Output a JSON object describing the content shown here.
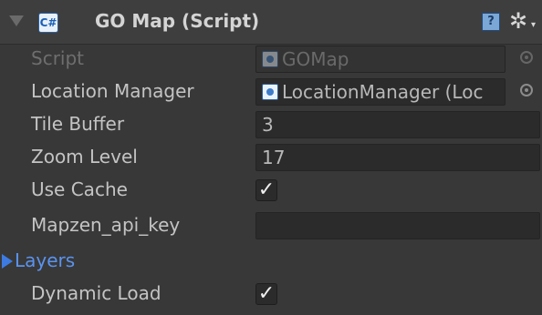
{
  "component": {
    "title": "GO Map (Script)",
    "script_icon_glyph": "C#",
    "help_glyph": "?",
    "gear_glyph": "✲",
    "gear_caret_glyph": "▾"
  },
  "fields": {
    "script": {
      "label": "Script",
      "value": "GOMap"
    },
    "location_manager": {
      "label": "Location Manager",
      "value": "LocationManager (Loc"
    },
    "tile_buffer": {
      "label": "Tile Buffer",
      "value": "3"
    },
    "zoom_level": {
      "label": "Zoom Level",
      "value": "17"
    },
    "use_cache": {
      "label": "Use Cache",
      "checked_glyph": "✓"
    },
    "mapzen_api_key": {
      "label": "Mapzen_api_key",
      "value": ""
    },
    "layers": {
      "label": "Layers"
    },
    "dynamic_load": {
      "label": "Dynamic Load",
      "checked_glyph": "✓"
    }
  },
  "colors": {
    "background": "#383838",
    "foldout_accent": "#5b93ee"
  }
}
